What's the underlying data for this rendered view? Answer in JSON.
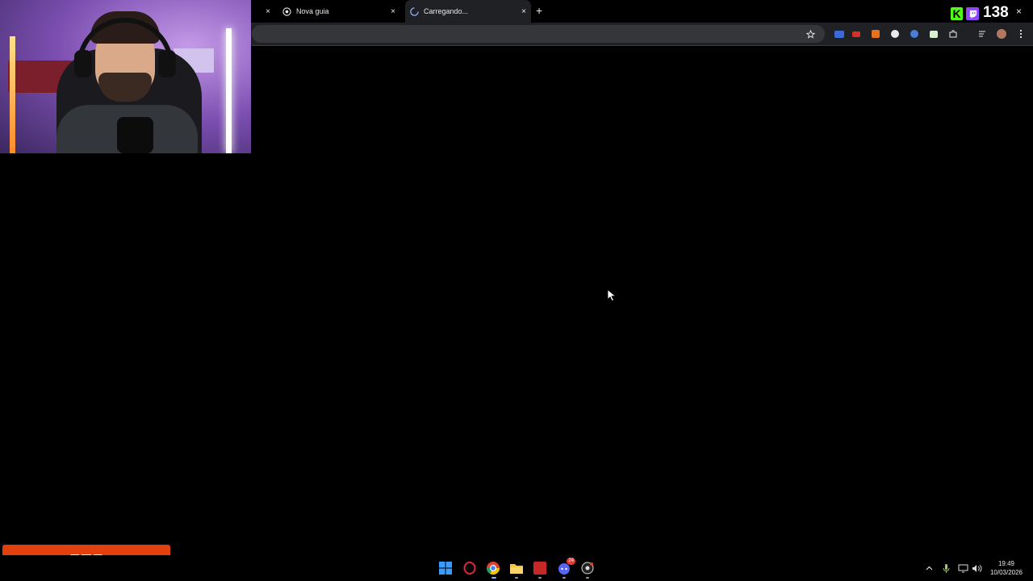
{
  "browser": {
    "tabs": [
      {
        "label": "Nova guia",
        "active": false,
        "icon": "chrome-icon"
      },
      {
        "label": "Carregando...",
        "active": true,
        "icon": "loading-spinner-icon"
      }
    ],
    "new_tab_label": "+",
    "close_label": "×"
  },
  "overlay": {
    "viewer_count": "138",
    "kick_letter": "K"
  },
  "taskbar": {
    "clock_time": "19:49",
    "clock_date": "10/03/2026",
    "discord_badge": "24"
  },
  "colors": {
    "overlay_bar": "#e2410f",
    "kick_green": "#53fc18",
    "twitch_purple": "#9146ff",
    "browser_toolbar": "#202124"
  }
}
